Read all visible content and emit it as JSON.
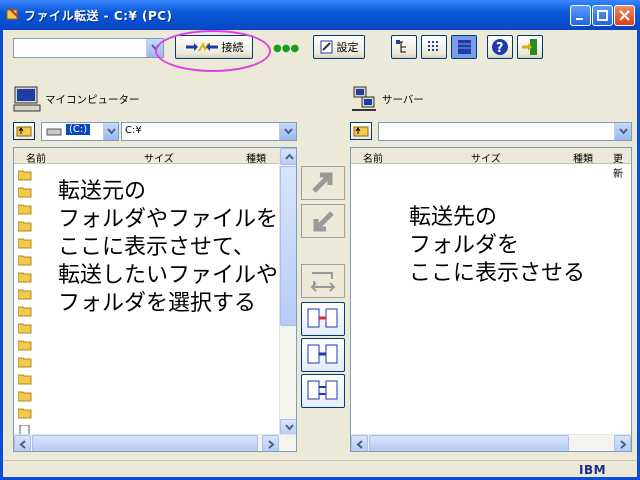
{
  "window": {
    "title": "ファイル転送 - C:¥ (PC)"
  },
  "toolbar": {
    "host_value": "",
    "connect_label": "接続",
    "status_dots": "●●●",
    "settings_label": "設定"
  },
  "local": {
    "title": "マイコンピューター",
    "drive_label": "(C:)",
    "path": "C:¥",
    "columns": [
      "名前",
      "サイズ",
      "種類"
    ],
    "instruction": [
      "転送元の",
      "フォルダやファイルを",
      "ここに表示させて、",
      "転送したいファイルや",
      "フォルダを選択する"
    ]
  },
  "remote": {
    "title": "サーバー",
    "path": "",
    "columns": [
      "名前",
      "サイズ",
      "種類",
      "更新"
    ],
    "instruction": [
      "転送先の",
      "フォルダを",
      "ここに表示させる"
    ]
  },
  "status": {
    "brand": "IBM"
  },
  "colors": {
    "accent": "#0a5ad8",
    "highlight": "#e040e0",
    "dots": "#1a9d1a"
  }
}
